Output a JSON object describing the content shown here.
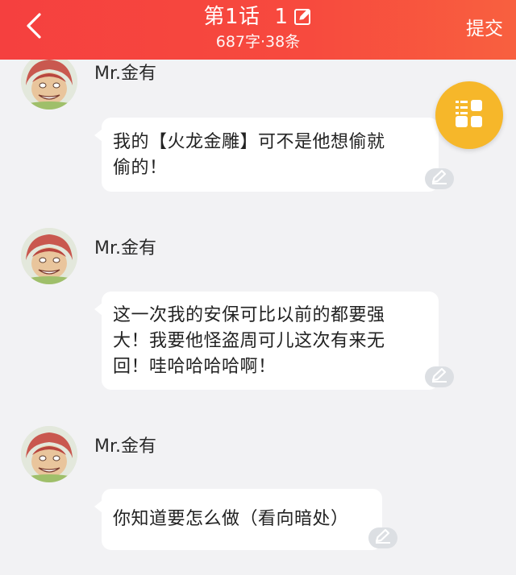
{
  "header": {
    "back_icon": "chevron-left-icon",
    "title": "第1话",
    "title_number": "1",
    "edit_icon": "edit-icon",
    "subtitle": "687字·38条",
    "submit_label": "提交",
    "bg_color": "#f5403f"
  },
  "fab": {
    "icon": "layout-grid-icon",
    "color": "#f6b72a"
  },
  "messages": [
    {
      "sender": "Mr.金有",
      "text_lines": [
        "我的【火龙金雕】可不是他想偷就",
        "偷的！"
      ]
    },
    {
      "sender": "Mr.金有",
      "text_lines": [
        "这一次我的安保可比以前的都要强",
        "大！我要他怪盗周可儿这次有来无",
        "回！哇哈哈哈哈啊！"
      ]
    },
    {
      "sender": "Mr.金有",
      "text_lines": [
        "你知道要怎么做（看向暗处）"
      ]
    }
  ]
}
